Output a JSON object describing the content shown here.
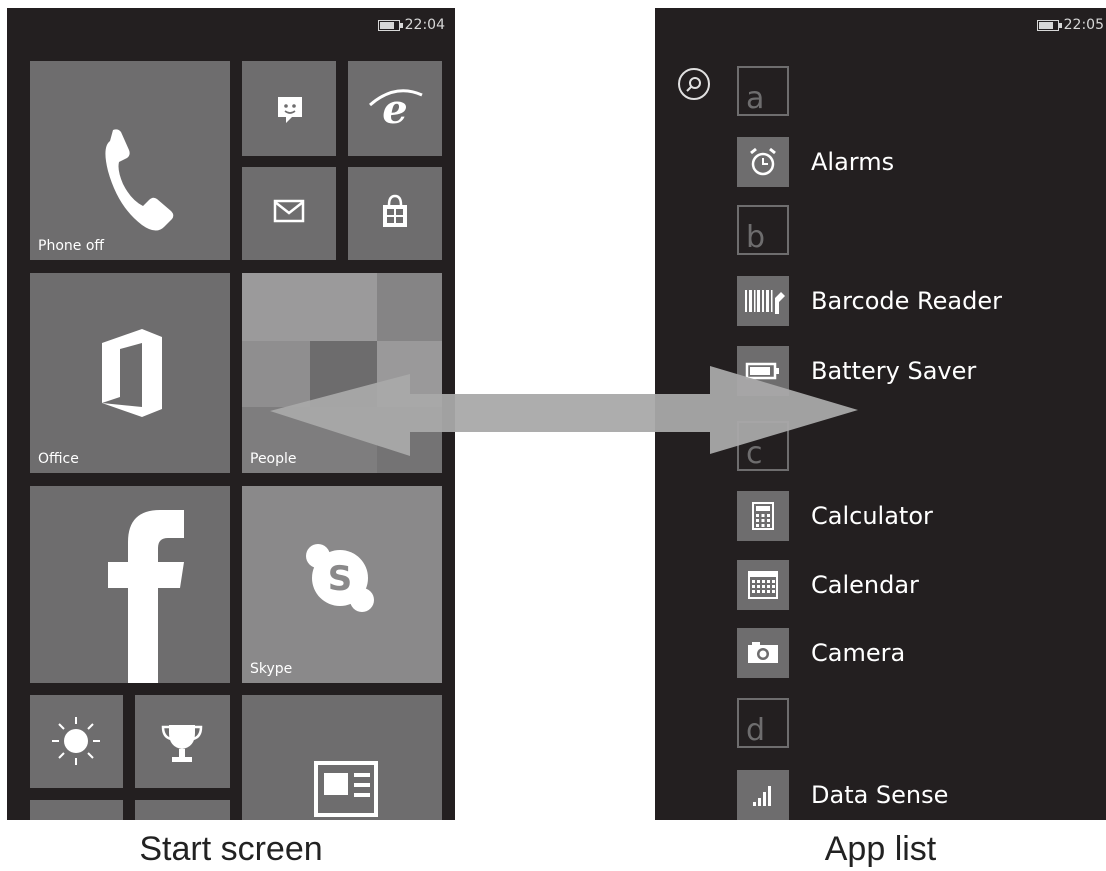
{
  "start_screen": {
    "status": {
      "time": "22:04"
    },
    "tiles": {
      "phone_label": "Phone off",
      "office_label": "Office",
      "people_label": "People",
      "skype_label": "Skype"
    },
    "caption": "Start screen"
  },
  "app_list": {
    "status": {
      "time": "22:05"
    },
    "letters": {
      "a": "a",
      "b": "b",
      "c": "c",
      "d": "d"
    },
    "apps": {
      "alarms": "Alarms",
      "barcode_reader": "Barcode Reader",
      "battery_saver": "Battery Saver",
      "calculator": "Calculator",
      "calendar": "Calendar",
      "camera": "Camera",
      "data_sense": "Data Sense"
    },
    "caption": "App list"
  },
  "colors": {
    "phone_bg": "#231f20",
    "tile": "#6e6d6e",
    "arrow": "#a9a9a9"
  }
}
